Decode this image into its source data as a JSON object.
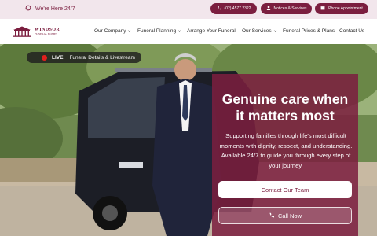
{
  "topbar": {
    "here_text": "We're Here 24/7",
    "buttons": [
      {
        "label": "(02) 4577 2322",
        "icon": "phone-icon"
      },
      {
        "label": "Notices & Services",
        "icon": "user-icon"
      },
      {
        "label": "Phone Appointment",
        "icon": "calendar-icon"
      }
    ]
  },
  "brand": {
    "name": "WINDSOR",
    "tagline": "FUNERAL HOMES"
  },
  "nav": {
    "items": [
      {
        "label": "Our Company",
        "dropdown": true
      },
      {
        "label": "Funeral Planning",
        "dropdown": true
      },
      {
        "label": "Arrange Your Funeral",
        "dropdown": false
      },
      {
        "label": "Our Services",
        "dropdown": true
      },
      {
        "label": "Funeral Prices & Plans",
        "dropdown": false
      },
      {
        "label": "Contact Us",
        "dropdown": false
      }
    ]
  },
  "live": {
    "badge": "LIVE",
    "text": "Funeral Details & Livestream"
  },
  "hero": {
    "headline_line1": "Genuine care when",
    "headline_line2": "it matters most",
    "subtext": "Supporting families through life's most difficult moments with dignity, respect, and understanding. Available 24/7 to guide you through every step of your journey.",
    "primary_cta": "Contact Our Team",
    "secondary_cta": "Call Now"
  },
  "colors": {
    "brand": "#7b1e3f",
    "topbar_bg": "#f2e6ec",
    "live_dot": "#e0201e"
  }
}
